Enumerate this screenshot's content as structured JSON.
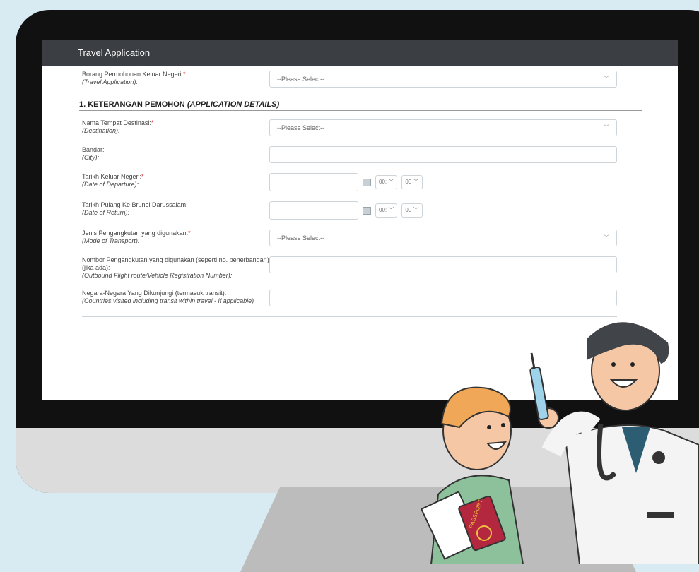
{
  "window": {
    "title": "Travel Application"
  },
  "form": {
    "travel_app": {
      "label": "Borang Permohonan Keluar Negeri:",
      "label_en": "(Travel Application):",
      "placeholder": "--Please Select--"
    },
    "section1": {
      "title": "1. KETERANGAN PEMOHON",
      "title_en": "(APPLICATION DETAILS)"
    },
    "destination": {
      "label": "Nama Tempat Destinasi:",
      "label_en": "(Destination):",
      "placeholder": "--Please Select--"
    },
    "city": {
      "label": "Bandar:",
      "label_en": "(City):",
      "value": ""
    },
    "departure": {
      "label": "Tarikh Keluar Negeri:",
      "label_en": "(Date of Departure):",
      "hour": "00:",
      "minute": "00"
    },
    "return": {
      "label": "Tarikh Pulang Ke Brunei Darussalam:",
      "label_en": "(Date of Return):",
      "hour": "00:",
      "minute": "00"
    },
    "transport": {
      "label": "Jenis Pengangkutan yang digunakan:",
      "label_en": "(Mode of Transport):",
      "placeholder": "--Please Select--"
    },
    "transport_no": {
      "label": "Nombor Pengangkutan yang digunakan (seperti no. penerbangan) (jika ada):",
      "label_en": "(Outbound Flight route/Vehicle Registration Number):",
      "value": ""
    },
    "countries": {
      "label": "Negara-Negara Yang Dikunjungi (termasuk transit):",
      "label_en": "(Countries visited including transit within travel - if applicable)",
      "value": ""
    }
  },
  "illustration": {
    "passport_text": "PASSPORT",
    "colors": {
      "screen_bar": "#3b3f43",
      "background": "#d8ebf2"
    }
  }
}
